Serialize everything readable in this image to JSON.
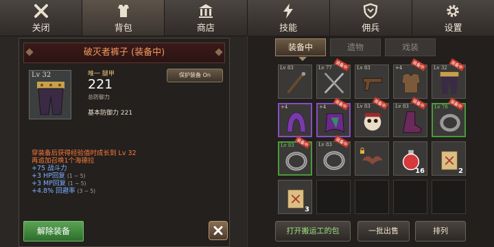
{
  "nav": {
    "items": [
      {
        "label": "关闭",
        "icon": "close-x-icon"
      },
      {
        "label": "背包",
        "icon": "armor-icon",
        "active": true
      },
      {
        "label": "商店",
        "icon": "shop-building-icon"
      },
      {
        "label": "技能",
        "icon": "lightning-icon"
      },
      {
        "label": "佣兵",
        "icon": "shield-icon"
      },
      {
        "label": "设置",
        "icon": "gear-icon"
      }
    ]
  },
  "detail": {
    "title": "破灭者裤子 (装备中)",
    "level": "Lv 32",
    "rarity": "唯一 腿甲",
    "defense_value": "221",
    "defense_label": "总防御力",
    "lock_button": "保护装备 On",
    "base_defense": "基本防御力 221",
    "growth_line_1": "穿装备后获得经验值时成长到 Lv 32",
    "growth_line_2": "再追加召唤1个海德拉",
    "stats": [
      {
        "text": "+75 战斗力",
        "range": ""
      },
      {
        "text": "+3 HP回复",
        "range": "(1 ~ 5)"
      },
      {
        "text": "+3 MP回复",
        "range": "(1 ~ 5)"
      },
      {
        "text": "+4.8% 回避率",
        "range": "(3 ~ 5)"
      }
    ],
    "unequip_button": "解除装备"
  },
  "inventory": {
    "tabs": [
      {
        "label": "装备中",
        "active": true
      },
      {
        "label": "遗物",
        "active": false
      },
      {
        "label": "戏装",
        "active": false
      }
    ],
    "slots": [
      {
        "level": "Lv 83",
        "icon": "staff-icon",
        "equipped": false,
        "border": "none"
      },
      {
        "level": "Lv 77",
        "icon": "crossed-swords-icon",
        "equipped": true,
        "equipped_label": "装备中",
        "border": "none"
      },
      {
        "level": "Lv 83",
        "icon": "pistol-icon",
        "equipped": false,
        "border": "none"
      },
      {
        "level": "+4",
        "icon": "leather-armor-icon",
        "equipped": true,
        "equipped_label": "装备中",
        "border": "none"
      },
      {
        "level": "Lv 32",
        "icon": "pants-icon",
        "equipped": true,
        "equipped_label": "装备中",
        "border": "none"
      },
      {
        "level": "+4",
        "icon": "purple-hood-icon",
        "equipped": false,
        "border": "purple"
      },
      {
        "level": "+4",
        "icon": "purple-cape-icon",
        "equipped": true,
        "equipped_label": "装备中",
        "border": "purple"
      },
      {
        "level": "Lv 83",
        "icon": "skull-helmet-icon",
        "equipped": true,
        "equipped_label": "装备中",
        "border": "none"
      },
      {
        "level": "Lv 83",
        "icon": "boots-icon",
        "equipped": true,
        "equipped_label": "装备中",
        "border": "none"
      },
      {
        "level": "Lv 78",
        "icon": "bracer-icon",
        "equipped": true,
        "equipped_label": "装备中",
        "border": "green"
      },
      {
        "level": "Lv 83",
        "icon": "ring-icon",
        "equipped": true,
        "equipped_label": "装备中",
        "border": "green"
      },
      {
        "level": "Lv 83",
        "icon": "ring-icon",
        "equipped": true,
        "equipped_label": "装备中",
        "border": "none"
      },
      {
        "level": "",
        "icon": "bat-wing-icon",
        "equipped": false,
        "locked": true,
        "border": "none"
      },
      {
        "level": "",
        "icon": "potion-icon",
        "equipped": false,
        "count": "16",
        "border": "none"
      },
      {
        "level": "",
        "icon": "scroll-icon",
        "equipped": false,
        "count": "2",
        "border": "none"
      },
      {
        "level": "",
        "icon": "scroll-icon",
        "equipped": false,
        "count": "3",
        "border": "none"
      }
    ],
    "bottom_buttons": {
      "open_bag": "打开搬运工的包",
      "bulk_sell": "一批出售",
      "sort": "排列"
    }
  },
  "colors": {
    "title_text": "#f29a5e",
    "growth_text": "#ff7a3a",
    "stat_text": "#7fb0ff",
    "green_border": "#4c9a3c",
    "purple_border": "#8a4ec2"
  }
}
